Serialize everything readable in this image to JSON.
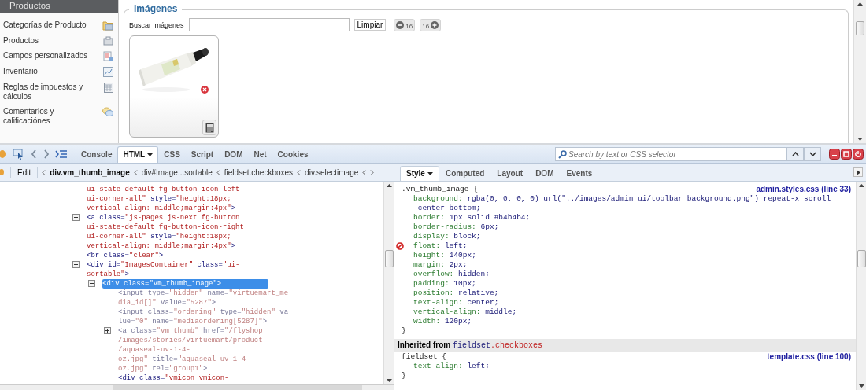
{
  "sidebar": {
    "header": "Productos",
    "items": [
      {
        "label": "Categorías de Producto"
      },
      {
        "label": "Productos"
      },
      {
        "label": "Campos personalizados"
      },
      {
        "label": "Inventario"
      },
      {
        "label": "Reglas de impuestos y cálculos"
      },
      {
        "label": "Comentarios y calificaciónes"
      }
    ]
  },
  "images": {
    "legend": "Imágenes",
    "search_label": "Buscar imágenes",
    "clear_button": "Limpiar",
    "pager": [
      {
        "kind": "prev",
        "label": "16"
      },
      {
        "kind": "next",
        "label": "16"
      }
    ]
  },
  "firebug": {
    "tabs": [
      {
        "label": "Console",
        "selected": false,
        "dropdown": false
      },
      {
        "label": "HTML",
        "selected": true,
        "dropdown": true
      },
      {
        "label": "CSS",
        "selected": false,
        "dropdown": false
      },
      {
        "label": "Script",
        "selected": false,
        "dropdown": false
      },
      {
        "label": "DOM",
        "selected": false,
        "dropdown": false
      },
      {
        "label": "Net",
        "selected": false,
        "dropdown": false
      },
      {
        "label": "Cookies",
        "selected": false,
        "dropdown": false
      }
    ],
    "search": {
      "placeholder": "Search by text or CSS selector"
    },
    "edit_button": "Edit",
    "breadcrumbs": [
      {
        "label": "div.vm_thumb_image",
        "selected": true
      },
      {
        "label": "div#Image...sortable",
        "selected": false
      },
      {
        "label": "fieldset.checkboxes",
        "selected": false
      },
      {
        "label": "div.selectimage",
        "selected": false
      }
    ],
    "side_tabs": [
      {
        "label": "Style",
        "selected": true,
        "dropdown": true
      },
      {
        "label": "Computed",
        "selected": false,
        "dropdown": false
      },
      {
        "label": "Layout",
        "selected": false,
        "dropdown": false
      },
      {
        "label": "DOM",
        "selected": false,
        "dropdown": false
      },
      {
        "label": "Events",
        "selected": false,
        "dropdown": false
      }
    ],
    "html_tree": [
      {
        "continued": true,
        "selected": false,
        "dimmed": false,
        "lines": [
          "ui-state-default fg-button-icon-left",
          "ui-corner-all\" style=\"height:18px;",
          "vertical-align: middle;margin:4px\">"
        ]
      },
      {
        "expanded": false,
        "selected": false,
        "dimmed": false,
        "lines": [
          "<a class=\"js-pages js-next fg-button",
          "ui-state-default fg-button-icon-right",
          "ui-corner-all\" style=\"height:18px;",
          "vertical-align: middle;margin:4px\">"
        ]
      },
      {
        "selected": false,
        "dimmed": false,
        "lines": [
          "<br class=\"clear\">"
        ]
      },
      {
        "expanded": true,
        "selected": false,
        "dimmed": false,
        "lines": [
          "<div id=\"ImagesContainer\" class=\"ui-",
          "sortable\">"
        ],
        "children": [
          {
            "expanded": true,
            "selected": true,
            "dimmed": false,
            "lines": [
              "<div class=\"vm_thumb_image\">"
            ],
            "children": [
              {
                "selected": false,
                "dimmed": true,
                "lines": [
                  "<input type=\"hidden\" name=\"virtuemart_me",
                  "dia_id[]\" value=\"5287\">"
                ]
              },
              {
                "selected": false,
                "dimmed": true,
                "lines": [
                  "<input class=\"ordering\" type=\"hidden\" va",
                  "lue=\"0\" name=\"mediaordering[5287]\">"
                ]
              },
              {
                "expanded": false,
                "selected": false,
                "dimmed": true,
                "lines": [
                  "<a class=\"vm_thumb\" href=\"/flyshop",
                  "/images/stories/virtuemart/product",
                  "/aquaseal-uv-1-4-",
                  "oz.jpg\" title=\"aquaseal-uv-1-4-",
                  "oz.jpg\" rel=\"group1\">"
                ]
              },
              {
                "selected": false,
                "dimmed": false,
                "lines": [
                  "<div class=\"vmicon vmicon-"
                ]
              }
            ]
          }
        ]
      }
    ],
    "style_rules": [
      {
        "selector": ".vm_thumb_image {",
        "source": "admin.styles.css (line 33)",
        "close": "}",
        "properties": [
          {
            "name": "background:",
            "value": "rgba(0, 0, 0, 0) url(\"../images/admin_ui/toolbar_background.png\") repeat-x scroll center bottom;",
            "disabled": false,
            "overridden": false
          },
          {
            "name": "border:",
            "value": "1px solid #b4b4b4;",
            "disabled": false,
            "overridden": false
          },
          {
            "name": "border-radius:",
            "value": "6px;",
            "disabled": false,
            "overridden": false
          },
          {
            "name": "display:",
            "value": "block;",
            "disabled": false,
            "overridden": false
          },
          {
            "name": "float:",
            "value": "left;",
            "disabled": true,
            "overridden": false
          },
          {
            "name": "height:",
            "value": "140px;",
            "disabled": false,
            "overridden": false
          },
          {
            "name": "margin:",
            "value": "2px;",
            "disabled": false,
            "overridden": false
          },
          {
            "name": "overflow:",
            "value": "hidden;",
            "disabled": false,
            "overridden": false
          },
          {
            "name": "padding:",
            "value": "10px;",
            "disabled": false,
            "overridden": false
          },
          {
            "name": "position:",
            "value": "relative;",
            "disabled": false,
            "overridden": false
          },
          {
            "name": "text-align:",
            "value": "center;",
            "disabled": false,
            "overridden": false
          },
          {
            "name": "vertical-align:",
            "value": "middle;",
            "disabled": false,
            "overridden": false
          },
          {
            "name": "width:",
            "value": "120px;",
            "disabled": false,
            "overridden": false
          }
        ]
      },
      {
        "inherited_from": {
          "label": "Inherited from",
          "element": "fieldset",
          "class": ".checkboxes"
        },
        "selector": "fieldset {",
        "source": "template.css (line 100)",
        "close": "}",
        "properties": [
          {
            "name": "text-align:",
            "value": "left;",
            "disabled": false,
            "overridden": true
          }
        ]
      }
    ]
  }
}
